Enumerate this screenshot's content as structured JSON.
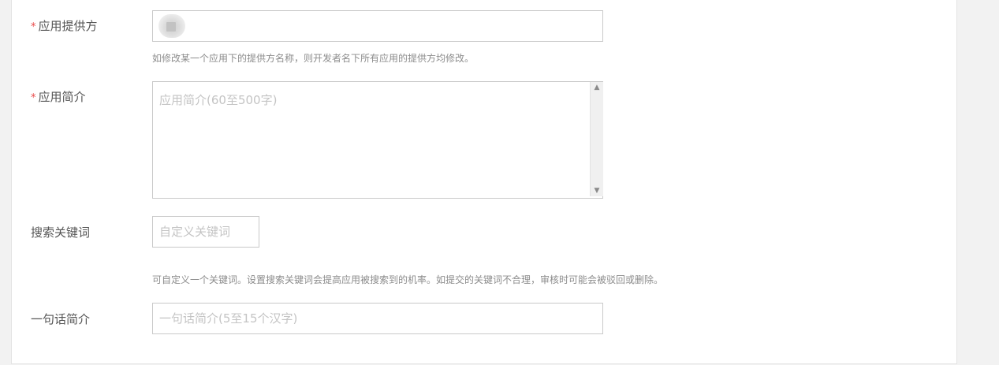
{
  "form": {
    "required_mark": "*",
    "provider": {
      "label": "应用提供方",
      "value": "",
      "hint": "如修改某一个应用下的提供方名称，则开发者名下所有应用的提供方均修改。"
    },
    "intro": {
      "label": "应用简介",
      "placeholder": "应用简介(60至500字)"
    },
    "keywords": {
      "label": "搜索关键词",
      "placeholder": "自定义关键词",
      "hint": "可自定义一个关键词。设置搜索关键词会提高应用被搜索到的机率。如提交的关键词不合理，审核时可能会被驳回或删除。"
    },
    "tagline": {
      "label": "一句话简介",
      "placeholder": "一句话简介(5至15个汉字)"
    }
  },
  "icons": {
    "scroll_up": "chevron-up-icon",
    "scroll_down": "chevron-down-icon"
  },
  "colors": {
    "required": "#e94b4b",
    "label": "#555555",
    "hint": "#8c8c8c",
    "placeholder": "#c4c4c4",
    "border": "#c9c9c9"
  }
}
